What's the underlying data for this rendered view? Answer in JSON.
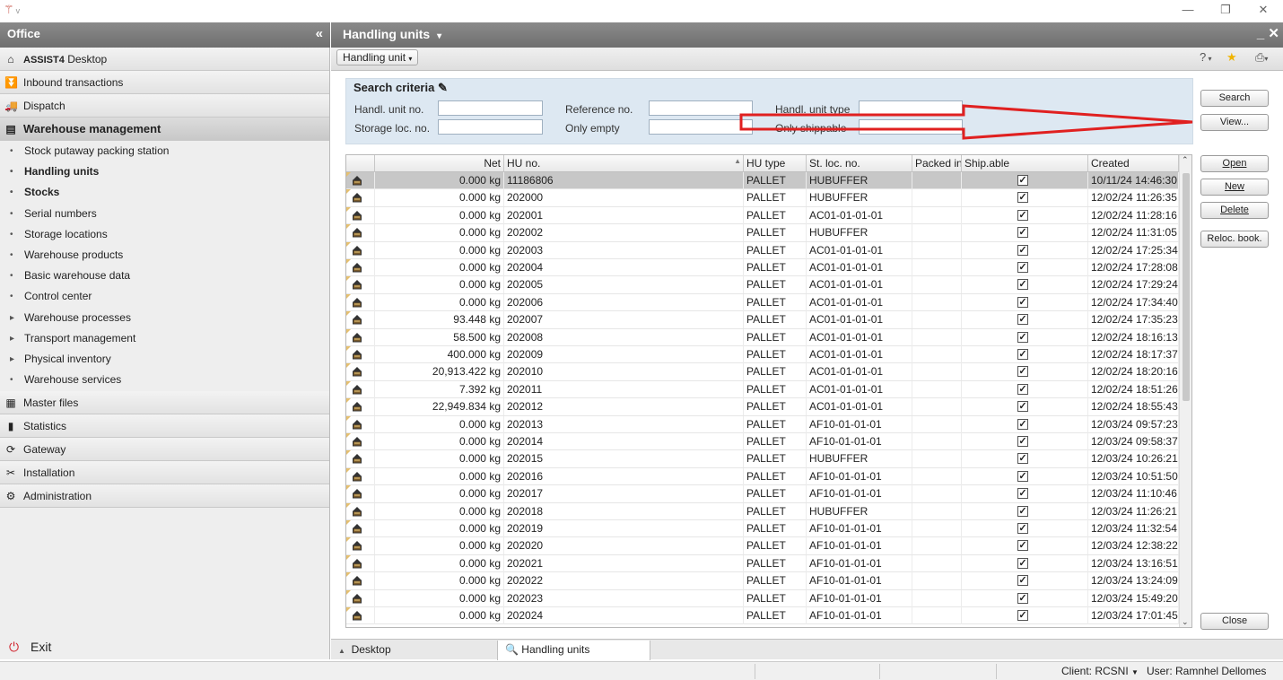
{
  "app": {
    "logo_suffix": "v"
  },
  "window_controls": {
    "minimize": "—",
    "restore": "❐",
    "close": "✕"
  },
  "sidebar": {
    "title": "Office",
    "collapse": "«",
    "brand": "ASSIST4",
    "desktop": "Desktop",
    "sections": [
      {
        "label": "Inbound transactions",
        "icon": "inbound-icon"
      },
      {
        "label": "Dispatch",
        "icon": "dispatch-icon"
      },
      {
        "label": "Warehouse management",
        "icon": "warehouse-icon"
      }
    ],
    "sub_items": [
      {
        "label": "Stock putaway packing station",
        "bullet": "•"
      },
      {
        "label": "Handling units",
        "bullet": "•"
      },
      {
        "label": "Stocks",
        "bullet": "•"
      },
      {
        "label": "Serial numbers",
        "bullet": "•"
      },
      {
        "label": "Storage locations",
        "bullet": "•"
      },
      {
        "label": "Warehouse products",
        "bullet": "•"
      },
      {
        "label": "Basic warehouse data",
        "bullet": "•"
      },
      {
        "label": "Control center",
        "bullet": "•"
      },
      {
        "label": "Warehouse processes",
        "bullet": "▸"
      },
      {
        "label": "Transport management",
        "bullet": "▸"
      },
      {
        "label": "Physical inventory",
        "bullet": "▸"
      },
      {
        "label": "Warehouse services",
        "bullet": "•"
      }
    ],
    "bottom_sections": [
      {
        "label": "Master files",
        "icon": "master-files-icon"
      },
      {
        "label": "Statistics",
        "icon": "statistics-icon"
      },
      {
        "label": "Gateway",
        "icon": "gateway-icon"
      },
      {
        "label": "Installation",
        "icon": "installation-icon"
      },
      {
        "label": "Administration",
        "icon": "administration-icon"
      }
    ],
    "exit": "Exit"
  },
  "main": {
    "title": "Handling units",
    "title_caret": "▾",
    "window_buttons": "_ ✕",
    "toolbar_dropdown": "Handling unit",
    "help": "?",
    "search": {
      "title": "Search criteria",
      "labels": {
        "handl_unit_no": "Handl. unit no.",
        "reference_no": "Reference no.",
        "handl_unit_type": "Handl. unit type",
        "storage_loc_no": "Storage loc. no.",
        "only_empty": "Only empty",
        "only_shippable": "Only shippable"
      }
    },
    "buttons": {
      "search": "Search",
      "view": "View...",
      "open": "Open",
      "new": "New",
      "delete": "Delete",
      "reloc": "Reloc. book.",
      "close": "Close"
    },
    "table": {
      "columns": [
        "Net",
        "HU no.",
        "HU type",
        "St. loc. no.",
        "Packed in",
        "Ship.able",
        "Created"
      ],
      "rows": [
        {
          "net": "0.000 kg",
          "hu": "11186806",
          "type": "PALLET",
          "loc": "HUBUFFER",
          "created": "10/11/24 14:46:30",
          "selected": true
        },
        {
          "net": "0.000 kg",
          "hu": "202000",
          "type": "PALLET",
          "loc": "HUBUFFER",
          "created": "12/02/24 11:26:35"
        },
        {
          "net": "0.000 kg",
          "hu": "202001",
          "type": "PALLET",
          "loc": "AC01-01-01-01",
          "created": "12/02/24 11:28:16"
        },
        {
          "net": "0.000 kg",
          "hu": "202002",
          "type": "PALLET",
          "loc": "HUBUFFER",
          "created": "12/02/24 11:31:05"
        },
        {
          "net": "0.000 kg",
          "hu": "202003",
          "type": "PALLET",
          "loc": "AC01-01-01-01",
          "created": "12/02/24 17:25:34"
        },
        {
          "net": "0.000 kg",
          "hu": "202004",
          "type": "PALLET",
          "loc": "AC01-01-01-01",
          "created": "12/02/24 17:28:08"
        },
        {
          "net": "0.000 kg",
          "hu": "202005",
          "type": "PALLET",
          "loc": "AC01-01-01-01",
          "created": "12/02/24 17:29:24"
        },
        {
          "net": "0.000 kg",
          "hu": "202006",
          "type": "PALLET",
          "loc": "AC01-01-01-01",
          "created": "12/02/24 17:34:40"
        },
        {
          "net": "93.448 kg",
          "hu": "202007",
          "type": "PALLET",
          "loc": "AC01-01-01-01",
          "created": "12/02/24 17:35:23"
        },
        {
          "net": "58.500 kg",
          "hu": "202008",
          "type": "PALLET",
          "loc": "AC01-01-01-01",
          "created": "12/02/24 18:16:13"
        },
        {
          "net": "400.000 kg",
          "hu": "202009",
          "type": "PALLET",
          "loc": "AC01-01-01-01",
          "created": "12/02/24 18:17:37"
        },
        {
          "net": "20,913.422 kg",
          "hu": "202010",
          "type": "PALLET",
          "loc": "AC01-01-01-01",
          "created": "12/02/24 18:20:16"
        },
        {
          "net": "7.392 kg",
          "hu": "202011",
          "type": "PALLET",
          "loc": "AC01-01-01-01",
          "created": "12/02/24 18:51:26"
        },
        {
          "net": "22,949.834 kg",
          "hu": "202012",
          "type": "PALLET",
          "loc": "AC01-01-01-01",
          "created": "12/02/24 18:55:43"
        },
        {
          "net": "0.000 kg",
          "hu": "202013",
          "type": "PALLET",
          "loc": "AF10-01-01-01",
          "created": "12/03/24 09:57:23"
        },
        {
          "net": "0.000 kg",
          "hu": "202014",
          "type": "PALLET",
          "loc": "AF10-01-01-01",
          "created": "12/03/24 09:58:37"
        },
        {
          "net": "0.000 kg",
          "hu": "202015",
          "type": "PALLET",
          "loc": "HUBUFFER",
          "created": "12/03/24 10:26:21"
        },
        {
          "net": "0.000 kg",
          "hu": "202016",
          "type": "PALLET",
          "loc": "AF10-01-01-01",
          "created": "12/03/24 10:51:50"
        },
        {
          "net": "0.000 kg",
          "hu": "202017",
          "type": "PALLET",
          "loc": "AF10-01-01-01",
          "created": "12/03/24 11:10:46"
        },
        {
          "net": "0.000 kg",
          "hu": "202018",
          "type": "PALLET",
          "loc": "HUBUFFER",
          "created": "12/03/24 11:26:21"
        },
        {
          "net": "0.000 kg",
          "hu": "202019",
          "type": "PALLET",
          "loc": "AF10-01-01-01",
          "created": "12/03/24 11:32:54"
        },
        {
          "net": "0.000 kg",
          "hu": "202020",
          "type": "PALLET",
          "loc": "AF10-01-01-01",
          "created": "12/03/24 12:38:22"
        },
        {
          "net": "0.000 kg",
          "hu": "202021",
          "type": "PALLET",
          "loc": "AF10-01-01-01",
          "created": "12/03/24 13:16:51"
        },
        {
          "net": "0.000 kg",
          "hu": "202022",
          "type": "PALLET",
          "loc": "AF10-01-01-01",
          "created": "12/03/24 13:24:09"
        },
        {
          "net": "0.000 kg",
          "hu": "202023",
          "type": "PALLET",
          "loc": "AF10-01-01-01",
          "created": "12/03/24 15:49:20"
        },
        {
          "net": "0.000 kg",
          "hu": "202024",
          "type": "PALLET",
          "loc": "AF10-01-01-01",
          "created": "12/03/24 17:01:45"
        }
      ]
    }
  },
  "tabs": {
    "desktop": "Desktop",
    "handling_units": "Handling units"
  },
  "status": {
    "client": "Client: RCSNI",
    "user": "User: Ramnhel Dellomes"
  },
  "colors": {
    "header": "#7a7a7a",
    "search_bg": "#dde8f2",
    "annotation_arrow": "#e02020",
    "exit_icon": "#d0202a"
  }
}
